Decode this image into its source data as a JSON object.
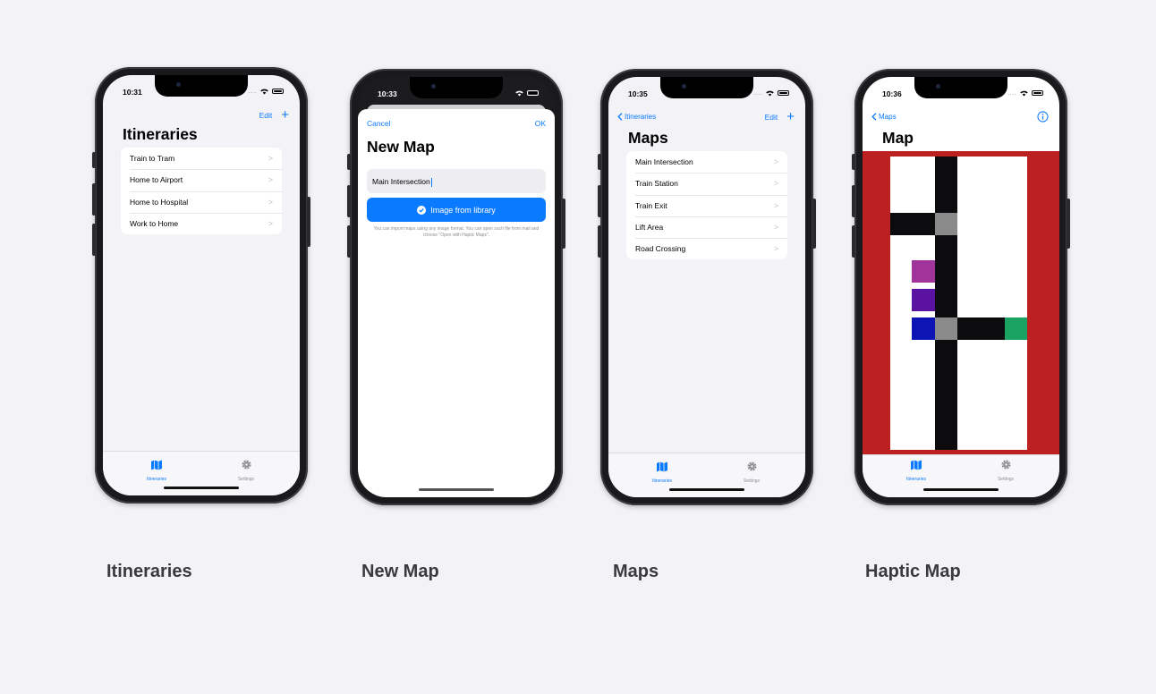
{
  "screens": {
    "itineraries": {
      "time": "10:31",
      "nav": {
        "edit": "Edit",
        "add": "+"
      },
      "title": "Itineraries",
      "items": [
        "Train to Tram",
        "Home to Airport",
        "Home to Hospital",
        "Work to Home"
      ],
      "tabs": {
        "itineraries": "Itineraries",
        "settings": "Settings"
      }
    },
    "new_map": {
      "time": "10:33",
      "cancel": "Cancel",
      "ok": "OK",
      "title": "New Map",
      "field_value": "Main Intersection",
      "button_label": "Image from library",
      "help_text": "You can import maps using any image format. You can open such file from mail and choose \"Open with Haptic Maps\"."
    },
    "maps": {
      "time": "10:35",
      "back": "Itineraries",
      "nav": {
        "edit": "Edit",
        "add": "+"
      },
      "title": "Maps",
      "items": [
        "Main Intersection",
        "Train Station",
        "Train Exit",
        "Lift Area",
        "Road Crossing"
      ],
      "tabs": {
        "itineraries": "Itineraries",
        "settings": "Settings"
      }
    },
    "haptic_map": {
      "time": "10:36",
      "back": "Maps",
      "title": "Map",
      "tabs": {
        "itineraries": "Itineraries",
        "settings": "Settings"
      },
      "colors": {
        "border": "#bd2020",
        "road": "#0c0c0e",
        "junction": "#8a8a8a",
        "magenta": "#a0349a",
        "purple": "#5b12a0",
        "blue": "#0c14b4",
        "green": "#1aa262"
      }
    }
  },
  "captions": [
    "Itineraries",
    "New Map",
    "Maps",
    "Haptic Map"
  ],
  "accent": "#0a7aff"
}
